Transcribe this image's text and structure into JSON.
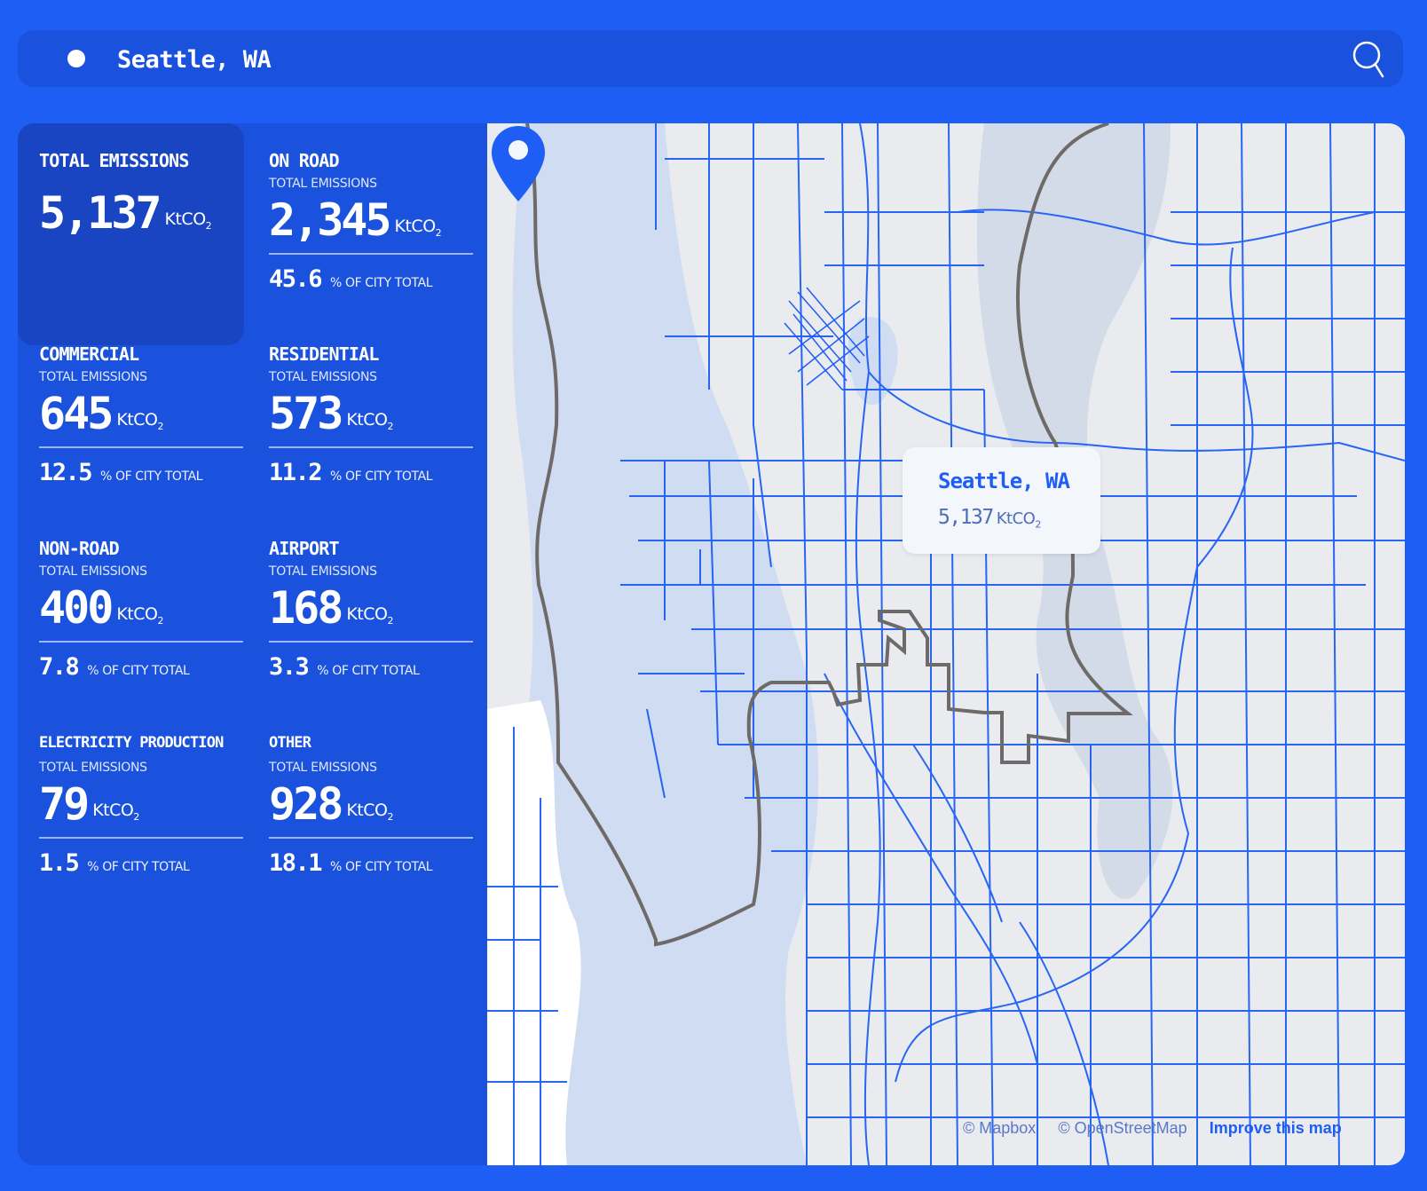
{
  "search": {
    "value": "Seattle, WA",
    "dot_icon": "location-dot-icon",
    "search_icon": "search-icon"
  },
  "metrics": [
    {
      "title": "TOTAL EMISSIONS",
      "subtitle": "",
      "value": "5,137",
      "unit": "KtCO",
      "unit_sub": "2",
      "pct": "",
      "pct_label": ""
    },
    {
      "title": "ON ROAD",
      "subtitle": "TOTAL EMISSIONS",
      "value": "2,345",
      "unit": "KtCO",
      "unit_sub": "2",
      "pct": "45.6",
      "pct_label": "% OF CITY TOTAL"
    },
    {
      "title": "COMMERCIAL",
      "subtitle": "TOTAL EMISSIONS",
      "value": "645",
      "unit": "KtCO",
      "unit_sub": "2",
      "pct": "12.5",
      "pct_label": "% OF CITY TOTAL"
    },
    {
      "title": "RESIDENTIAL",
      "subtitle": "TOTAL EMISSIONS",
      "value": "573",
      "unit": "KtCO",
      "unit_sub": "2",
      "pct": "11.2",
      "pct_label": "% OF CITY TOTAL"
    },
    {
      "title": "NON-ROAD",
      "subtitle": "TOTAL EMISSIONS",
      "value": "400",
      "unit": "KtCO",
      "unit_sub": "2",
      "pct": "7.8",
      "pct_label": "% OF CITY TOTAL"
    },
    {
      "title": "AIRPORT",
      "subtitle": "TOTAL EMISSIONS",
      "value": "168",
      "unit": "KtCO",
      "unit_sub": "2",
      "pct": "3.3",
      "pct_label": "% OF CITY TOTAL"
    },
    {
      "title": "ELECTRICITY PRODUCTION",
      "subtitle": "TOTAL EMISSIONS",
      "value": "79",
      "unit": "KtCO",
      "unit_sub": "2",
      "pct": "1.5",
      "pct_label": "% OF CITY TOTAL"
    },
    {
      "title": "OTHER",
      "subtitle": "TOTAL EMISSIONS",
      "value": "928",
      "unit": "KtCO",
      "unit_sub": "2",
      "pct": "18.1",
      "pct_label": "% OF CITY TOTAL"
    }
  ],
  "map": {
    "popup": {
      "title": "Seattle, WA",
      "value": "5,137",
      "unit": "KtCO",
      "unit_sub": "2"
    },
    "pin_icon": "map-pin-icon",
    "attribution": {
      "mapbox": "© Mapbox",
      "osm": "© OpenStreetMap",
      "improve": "Improve this map"
    },
    "colors": {
      "water": "#cfdcf2",
      "land": "#e9ebef",
      "roads": "#1f5ef5",
      "boundary": "#6e6a68"
    }
  },
  "colors": {
    "background": "#1f5ef5",
    "panel": "#1a52dd",
    "highlight": "#1944c2",
    "text": "#ffffff"
  }
}
